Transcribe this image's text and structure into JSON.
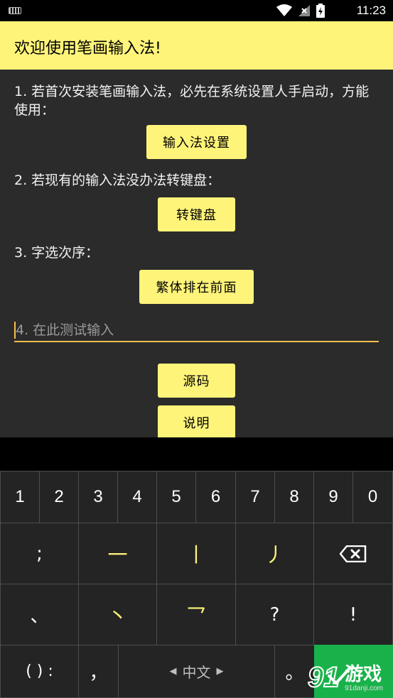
{
  "status_bar": {
    "time": "11:23"
  },
  "app_bar": {
    "title": "欢迎使用笔画输入法!"
  },
  "content": {
    "step1_text": "1. 若首次安装笔画输入法，必先在系统设置人手启动，方能使用：",
    "step1_button": "输入法设置",
    "step2_text": "2. 若现有的输入法没办法转键盘：",
    "step2_button": "转键盘",
    "step3_text": "3. 字选次序：",
    "step3_button": "繁体排在前面",
    "test_placeholder": "4. 在此测试输入",
    "source_button": "源码",
    "help_button": "说明"
  },
  "keyboard": {
    "digits": [
      "1",
      "2",
      "3",
      "4",
      "5",
      "6",
      "7",
      "8",
      "9",
      "0"
    ],
    "row2": [
      ";",
      "一",
      "丨",
      "丿"
    ],
    "row3": [
      "、",
      "丶",
      "乛",
      "?",
      "!"
    ],
    "row4": {
      "paren": "( ) :",
      "comma": "，",
      "lang": "中文",
      "period": "。"
    },
    "stroke_color": "#FFF47A"
  },
  "watermark": {
    "brand": "游戏",
    "site": "91danji.com"
  },
  "colors": {
    "accent": "#FFF47A",
    "content_bg": "#2B2B2B",
    "underline": "#F5C04D",
    "enter": "#19B24A"
  }
}
